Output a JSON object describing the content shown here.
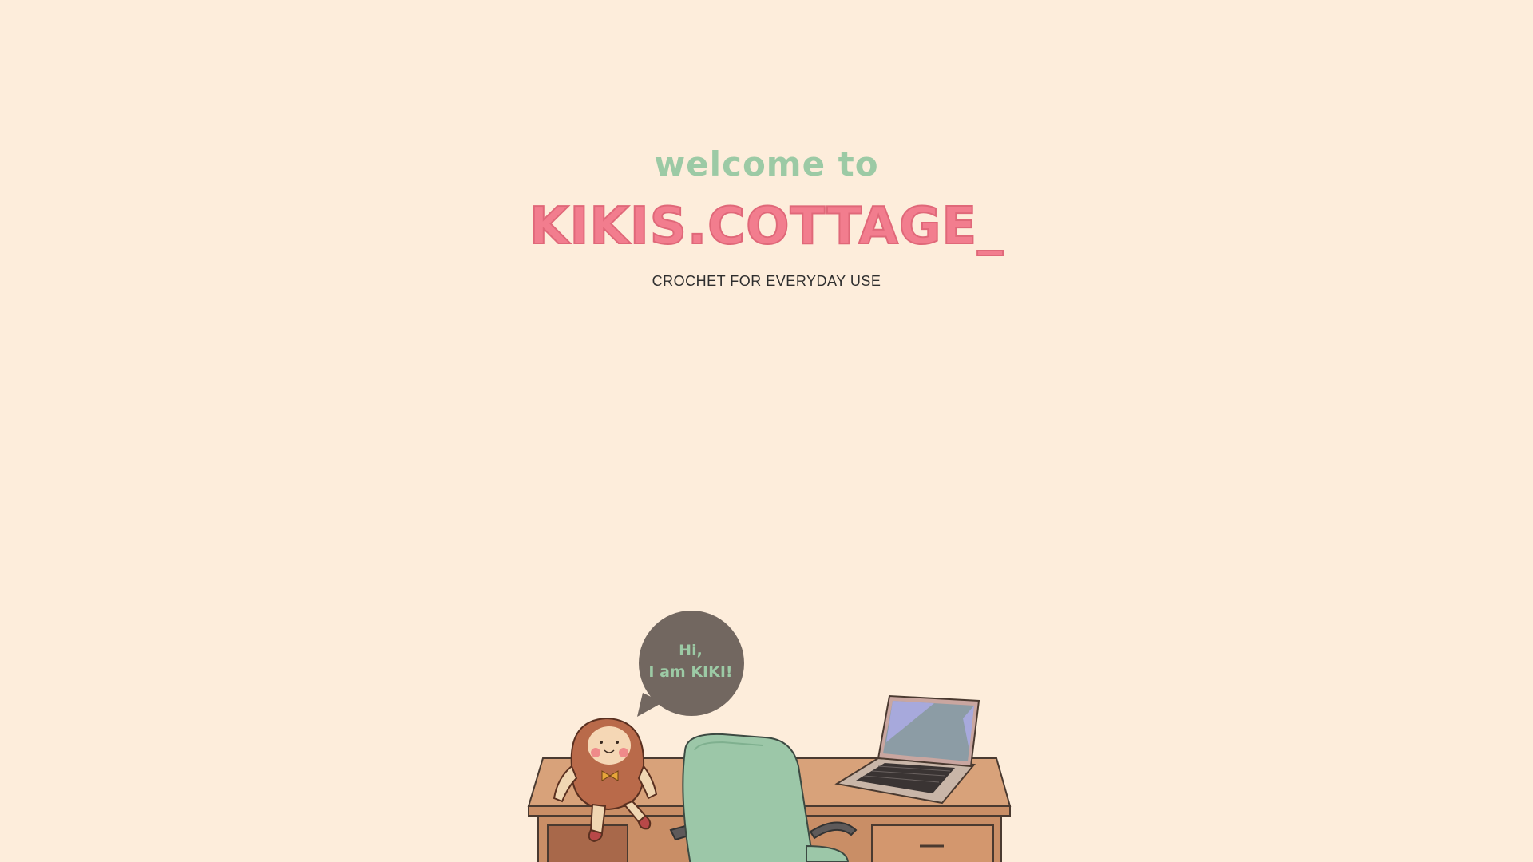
{
  "hero": {
    "welcome": "welcome to",
    "brand": "KIKIS.COTTAGE_",
    "tagline": "CROCHET FOR EVERYDAY USE"
  },
  "speech_bubble": {
    "line1": "Hi,",
    "line2": "I am KIKI!"
  },
  "illustration": {
    "icons": [
      "crochet-doll-icon",
      "desk-icon",
      "office-chair-icon",
      "laptop-icon",
      "speech-bubble-icon"
    ]
  },
  "colors": {
    "background": "#fdeddb",
    "welcome": "#9ccaa5",
    "brand": "#f27d8e",
    "bubble": "#726760"
  }
}
